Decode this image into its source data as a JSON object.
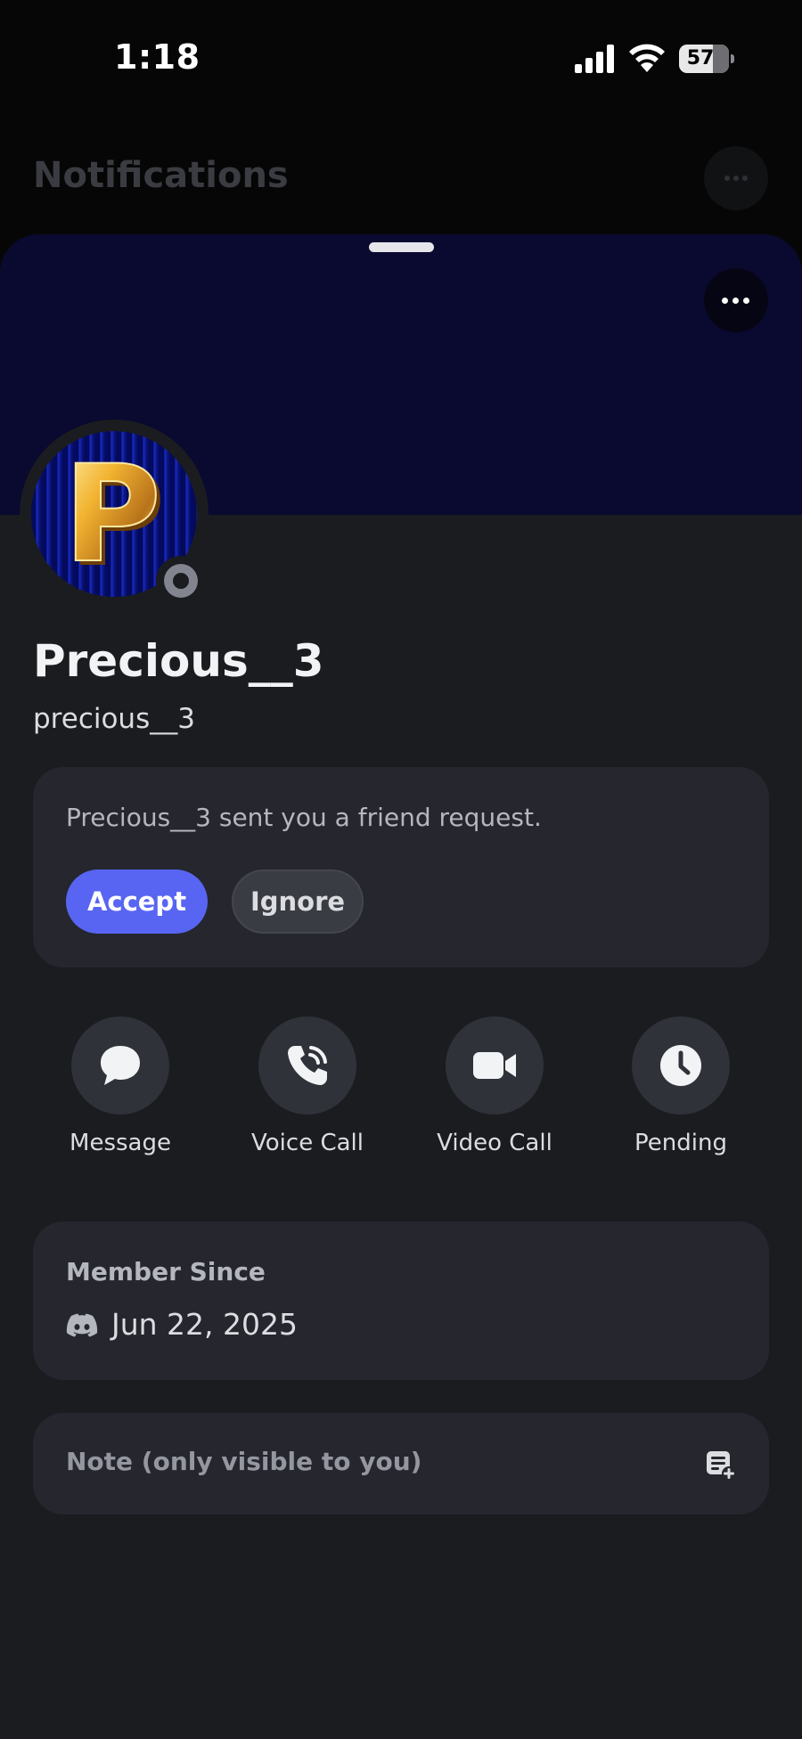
{
  "status_bar": {
    "time": "1:18",
    "battery_level": "57",
    "icons": [
      "cellular-signal-icon",
      "wifi-icon",
      "battery-icon"
    ]
  },
  "background_page": {
    "title": "Notifications"
  },
  "profile": {
    "display_name": "Precious__3",
    "username": "precious__3",
    "avatar_letter": "P",
    "online_status": "offline",
    "banner_color": "#0a0930"
  },
  "friend_request": {
    "message": "Precious__3 sent you a friend request.",
    "accept_label": "Accept",
    "ignore_label": "Ignore"
  },
  "actions": [
    {
      "label": "Message",
      "icon": "message-bubble-icon"
    },
    {
      "label": "Voice Call",
      "icon": "phone-call-icon"
    },
    {
      "label": "Video Call",
      "icon": "video-camera-icon"
    },
    {
      "label": "Pending",
      "icon": "clock-icon"
    }
  ],
  "member_since": {
    "title": "Member Since",
    "date": "Jun 22, 2025",
    "icon": "discord-logo-icon"
  },
  "note": {
    "placeholder": "Note (only visible to you)",
    "icon": "add-note-icon"
  },
  "colors": {
    "accent": "#5865f2",
    "sheet_background": "#1b1c20",
    "card_background": "#25262e"
  }
}
